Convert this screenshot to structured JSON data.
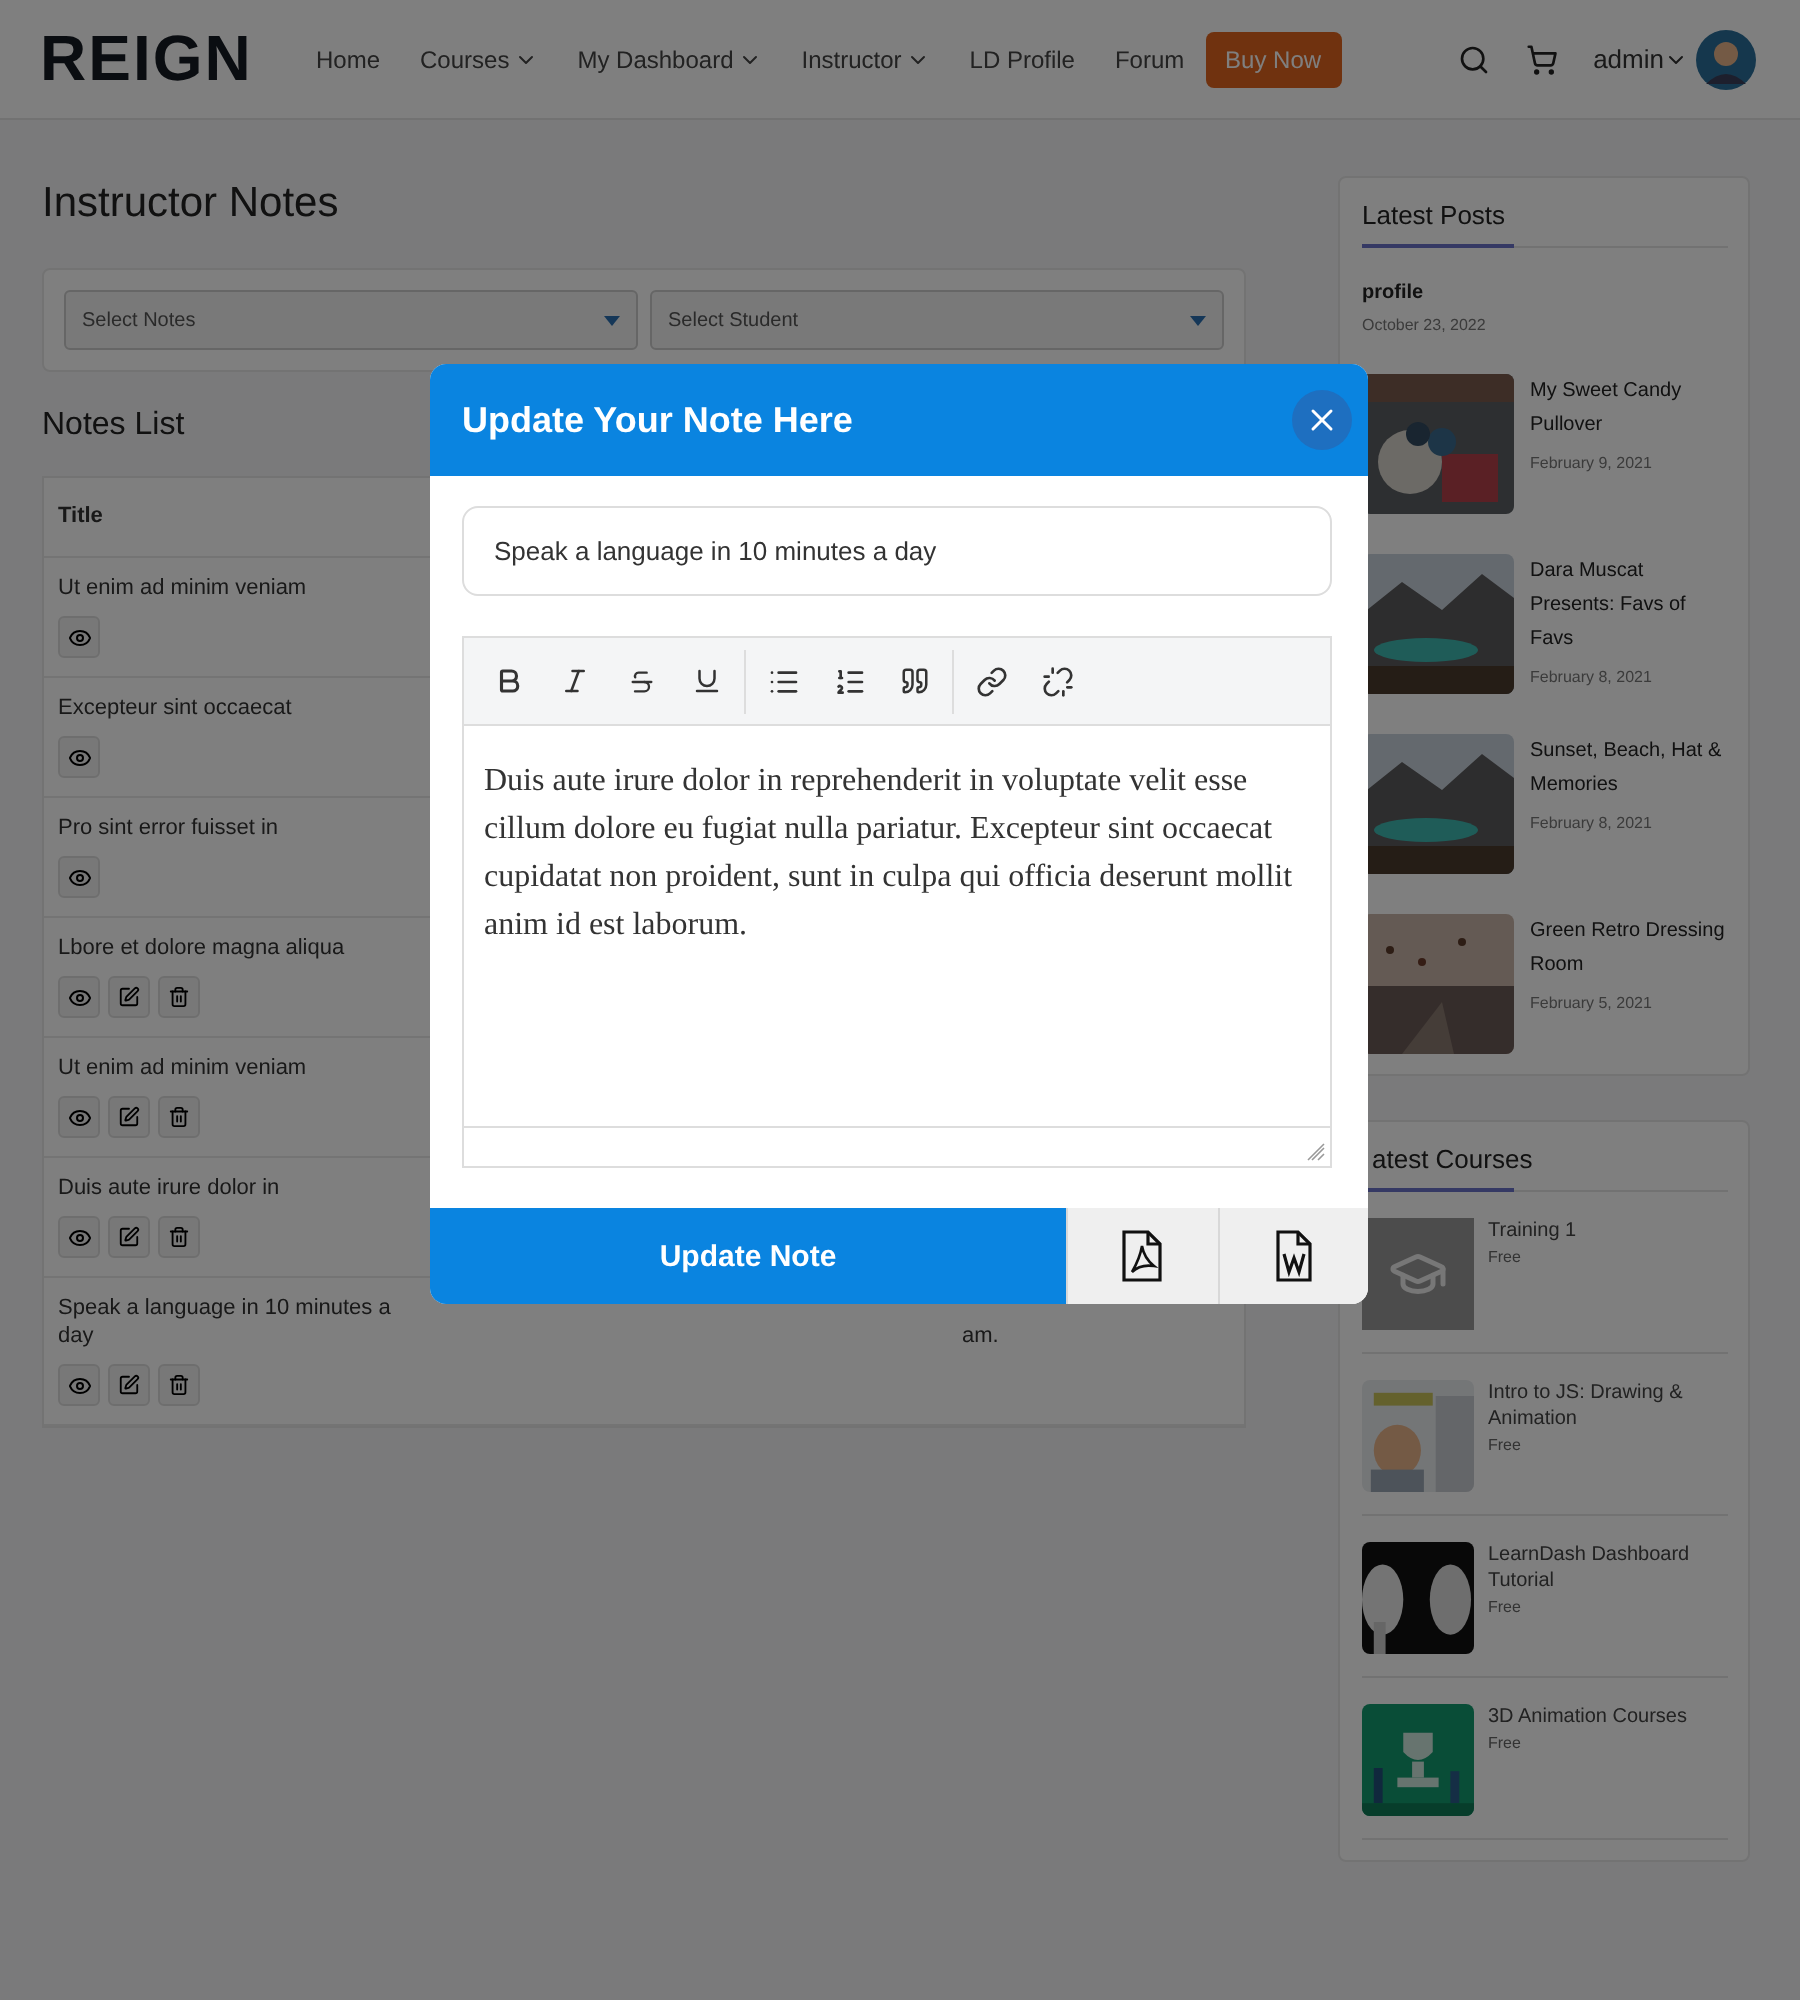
{
  "header": {
    "logo": "REIGN",
    "nav": [
      {
        "label": "Home",
        "has_menu": false
      },
      {
        "label": "Courses",
        "has_menu": true
      },
      {
        "label": "My Dashboard",
        "has_menu": true
      },
      {
        "label": "Instructor",
        "has_menu": true
      },
      {
        "label": "LD Profile",
        "has_menu": false
      },
      {
        "label": "Forum",
        "has_menu": false
      }
    ],
    "cta": "Buy Now",
    "user": "admin"
  },
  "page": {
    "title": "Instructor Notes",
    "filters": [
      {
        "placeholder": "Select Notes"
      },
      {
        "placeholder": "Select Student"
      }
    ],
    "list_title": "Notes List",
    "table": {
      "columns": [
        "Title"
      ],
      "rows": [
        {
          "title": "Ut enim ad minim veniam",
          "editable": false
        },
        {
          "title": "Excepteur sint occaecat",
          "editable": false
        },
        {
          "title": "Pro sint error fuisset in",
          "editable": false
        },
        {
          "title": "Lbore et dolore magna aliqua",
          "editable": true
        },
        {
          "title": "Ut enim ad minim veniam",
          "editable": true
        },
        {
          "title": "Duis aute irure dolor in",
          "editable": true
        },
        {
          "title": "Speak a language in 10 minutes a day",
          "editable": true,
          "column_3": "am."
        }
      ]
    }
  },
  "sidebar": {
    "posts_title": "Latest Posts",
    "featured": {
      "title": "profile",
      "date": "October 23, 2022"
    },
    "posts": [
      {
        "title": "My Sweet Candy Pullover",
        "date": "February 9, 2021"
      },
      {
        "title": "Dara Muscat Presents: Favs of Favs",
        "date": "February 8, 2021"
      },
      {
        "title": "Sunset, Beach, Hat & Memories",
        "date": "February 8, 2021"
      },
      {
        "title": "Green Retro Dressing Room",
        "date": "February 5, 2021"
      }
    ],
    "courses_title": "atest Courses",
    "courses": [
      {
        "title": "Training 1",
        "price": "Free",
        "kind": "placeholder"
      },
      {
        "title": "Intro to JS: Drawing & Animation",
        "price": "Free",
        "kind": "picture"
      },
      {
        "title": "LearnDash Dashboard Tutorial",
        "price": "Free",
        "kind": "picture"
      },
      {
        "title": "3D Animation Courses",
        "price": "Free",
        "kind": "picture"
      }
    ]
  },
  "modal": {
    "title": "Update Your Note Here",
    "note_title": "Speak a language in 10 minutes a day",
    "body": "Duis aute irure dolor in reprehenderit in voluptate velit esse cillum dolore eu fugiat nulla pariatur. Excepteur sint occaecat cupidatat non proident, sunt in culpa qui officia deserunt mollit anim id est laborum.",
    "submit": "Update Note"
  }
}
